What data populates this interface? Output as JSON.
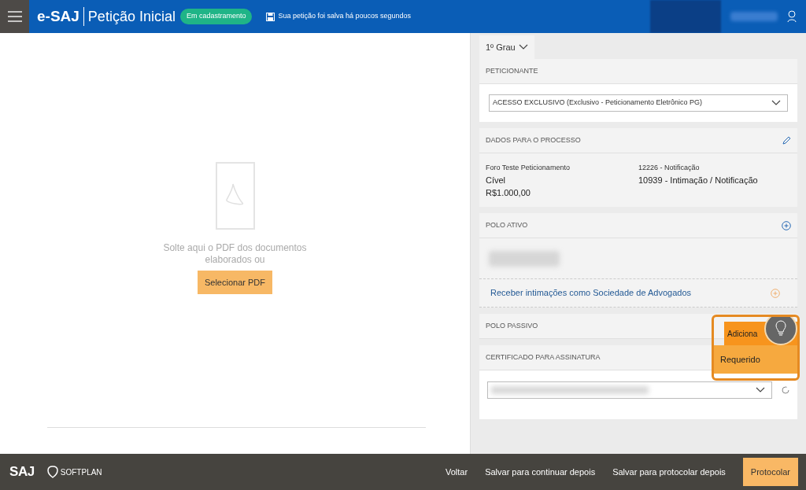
{
  "header": {
    "brand": "e-SAJ",
    "title": "Petição Inicial",
    "status_badge": "Em cadastramento",
    "save_notice": "Sua petição foi salva há poucos segundos"
  },
  "drop_area": {
    "message": "Solte aqui o PDF dos documentos elaborados ou",
    "button": "Selecionar PDF"
  },
  "instance": {
    "label": "1º Grau"
  },
  "peticionante": {
    "title": "PETICIONANTE",
    "value": "ACESSO EXCLUSIVO (Exclusivo - Peticionamento Eletrônico PG)"
  },
  "dados": {
    "title": "DADOS PARA O PROCESSO",
    "left": [
      "Foro Teste Peticionamento",
      "Cível",
      "R$1.000,00"
    ],
    "right": [
      "12226 - Notificação",
      "10939 - Intimação / Notificação"
    ]
  },
  "polo_ativo": {
    "title": "POLO ATIVO",
    "link": "Receber intimações como Sociedade de Advogados"
  },
  "polo_passivo": {
    "title": "POLO PASSIVO",
    "add_button": "Adiciona",
    "menu_items": [
      "Requerido"
    ]
  },
  "certificado": {
    "title": "CERTIFICADO PARA ASSINATURA"
  },
  "footer": {
    "logo": "SAJ",
    "company": "SOFTPLAN",
    "actions": [
      {
        "label": "Voltar",
        "kind": "link"
      },
      {
        "label": "Salvar para continuar depois",
        "kind": "link"
      },
      {
        "label": "Salvar para protocolar depois",
        "kind": "link"
      },
      {
        "label": "Protocolar",
        "kind": "primary"
      }
    ]
  }
}
